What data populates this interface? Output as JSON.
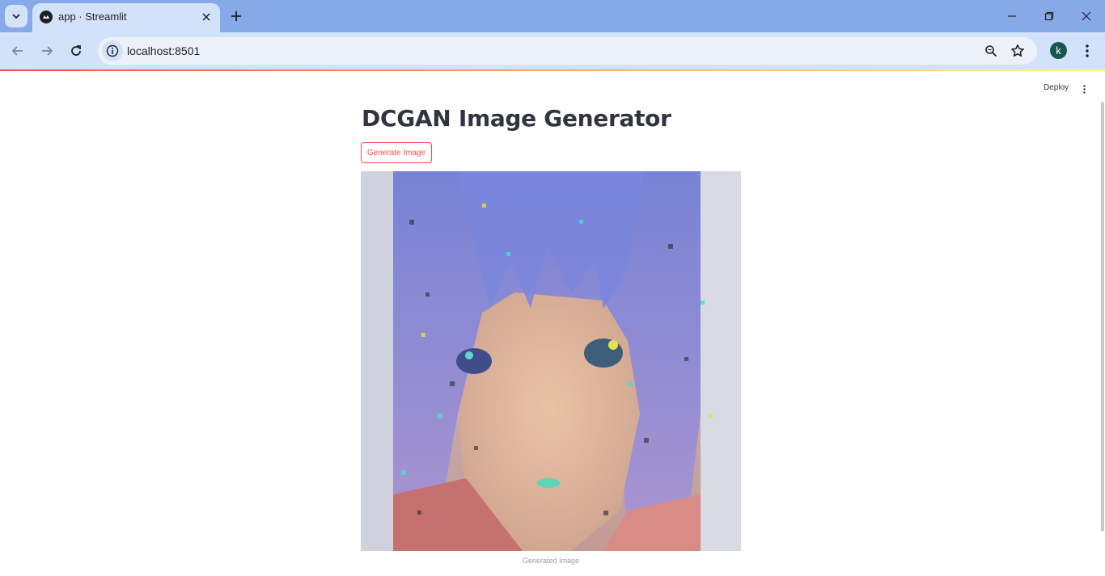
{
  "browser": {
    "tab_title": "app · Streamlit",
    "url": "localhost:8501",
    "profile_initial": "k"
  },
  "app": {
    "deploy_label": "Deploy",
    "title": "DCGAN Image Generator",
    "generate_button_label": "Generate Image",
    "image_caption": "Generated Image"
  },
  "colors": {
    "accent": "#ff4b4b",
    "tabbar": "#87a9e8",
    "toolbar": "#d3e2fb"
  }
}
